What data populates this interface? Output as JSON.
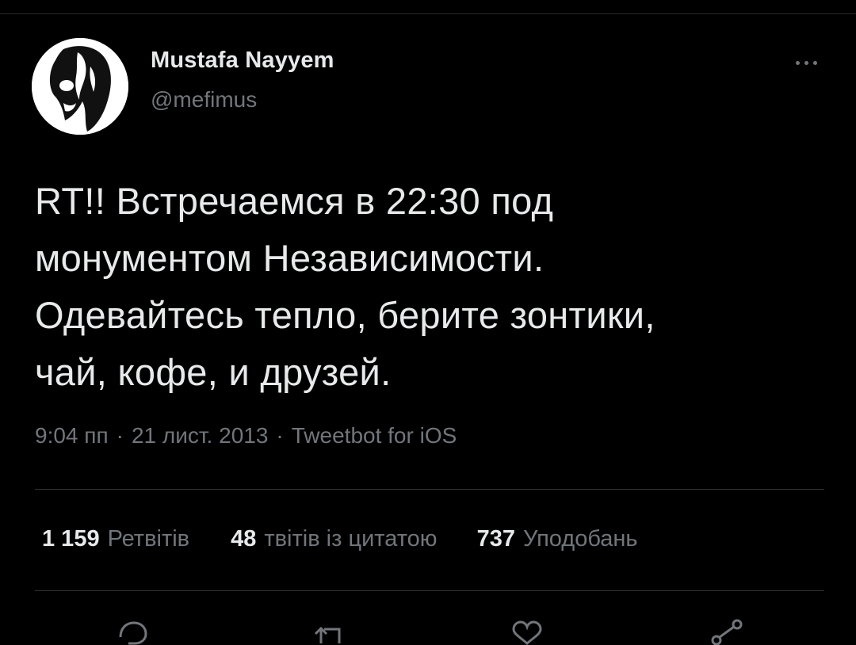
{
  "tweet": {
    "author": {
      "display_name": "Mustafa Nayyem",
      "handle": "@mefimus",
      "avatar_icon": "mask-avatar-icon"
    },
    "more_icon": "more-horizontal-icon",
    "text": "RT!! Встречаемся в 22:30 под\nмонументом Независимости.\nОдевайтесь тепло, берите зонтики,\nчай, кофе, и друзей.",
    "time": "9:04 пп",
    "date": "21 лист. 2013",
    "separator": "·",
    "source": "Tweetbot for iOS"
  },
  "stats": {
    "retweets": {
      "count": "1 159",
      "label": "Ретвітів"
    },
    "quotes": {
      "count": "48",
      "label": "твітів із цитатою"
    },
    "likes": {
      "count": "737",
      "label": "Уподобань"
    }
  },
  "actions": [
    {
      "icon": "reply-icon"
    },
    {
      "icon": "retweet-icon"
    },
    {
      "icon": "like-icon"
    },
    {
      "icon": "share-icon"
    }
  ],
  "colors": {
    "background": "#000000",
    "primary_text": "#e7e9ea",
    "secondary_text": "#71767b",
    "divider": "#2f3336"
  }
}
